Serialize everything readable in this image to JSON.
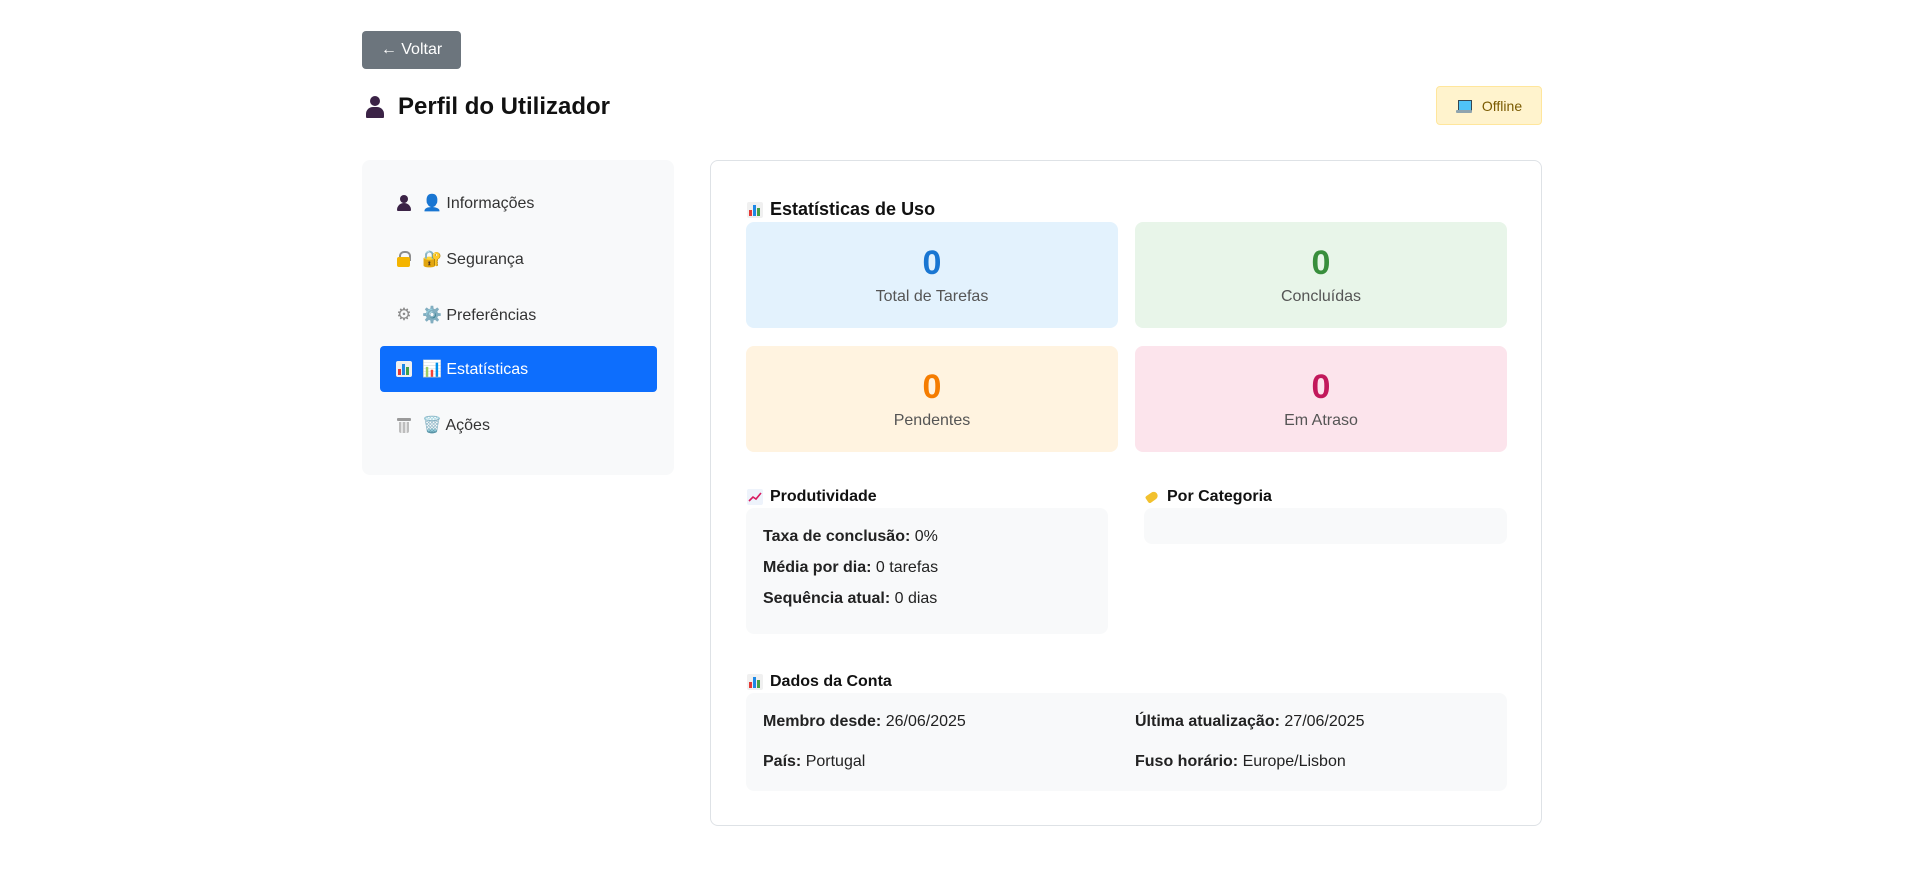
{
  "header": {
    "back_label": "← Voltar",
    "title": "Perfil do Utilizador",
    "status": "Offline"
  },
  "sidebar": {
    "items": [
      {
        "label": "👤 Informações",
        "icon": "user-icon",
        "active": false
      },
      {
        "label": "🔐 Segurança",
        "icon": "lock-icon",
        "active": false
      },
      {
        "label": "⚙️ Preferências",
        "icon": "gear-icon",
        "active": false
      },
      {
        "label": "📊 Estatísticas",
        "icon": "bar-chart-icon",
        "active": true
      },
      {
        "label": "🗑️ Ações",
        "icon": "trash-icon",
        "active": false
      }
    ]
  },
  "stats": {
    "title": "Estatísticas de Uso",
    "cards": [
      {
        "value": "0",
        "label": "Total de Tarefas",
        "color": "#1976d2",
        "bg": "#e3f2fd"
      },
      {
        "value": "0",
        "label": "Concluídas",
        "color": "#388e3c",
        "bg": "#e8f5e9"
      },
      {
        "value": "0",
        "label": "Pendentes",
        "color": "#f57c00",
        "bg": "#fff3e0"
      },
      {
        "value": "0",
        "label": "Em Atraso",
        "color": "#c2185b",
        "bg": "#fce4ec"
      }
    ]
  },
  "productivity": {
    "title": "Produtividade",
    "rows": [
      {
        "label": "Taxa de conclusão:",
        "value": "0%"
      },
      {
        "label": "Média por dia:",
        "value": "0 tarefas"
      },
      {
        "label": "Sequência atual:",
        "value": "0 dias"
      }
    ]
  },
  "category": {
    "title": "Por Categoria"
  },
  "account": {
    "title": "Dados da Conta",
    "member_since_label": "Membro desde:",
    "member_since": "26/06/2025",
    "last_update_label": "Última atualização:",
    "last_update": "27/06/2025",
    "country_label": "País:",
    "country": "Portugal",
    "timezone_label": "Fuso horário:",
    "timezone": "Europe/Lisbon"
  }
}
